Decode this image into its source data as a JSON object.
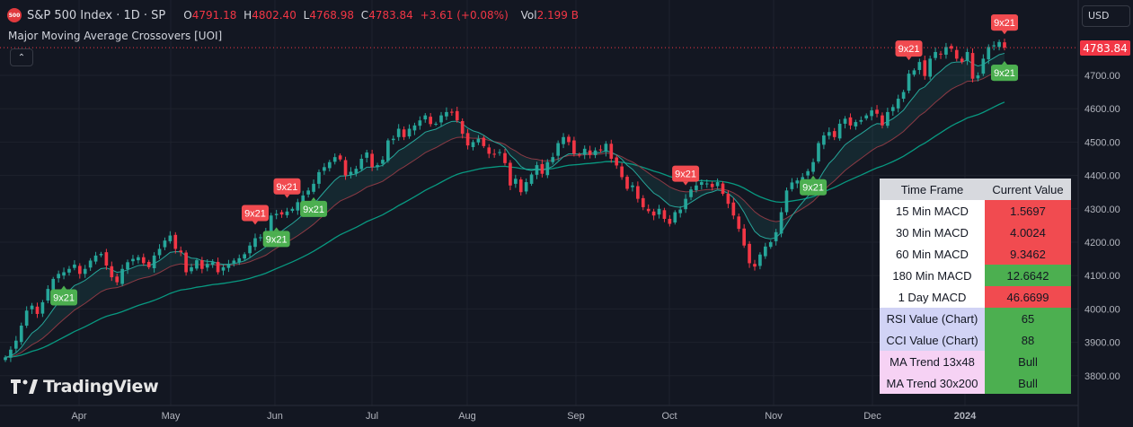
{
  "header": {
    "logo_text": "500",
    "symbol": "S&P 500 Index · 1D · SP",
    "o_label": "O",
    "o": "4791.18",
    "h_label": "H",
    "h": "4802.40",
    "l_label": "L",
    "l": "4768.98",
    "c_label": "C",
    "c": "4783.84",
    "change": "+3.61 (+0.08%)",
    "vol_label": "Vol",
    "vol": "2.199 B"
  },
  "indicator_title": "Major Moving Average Crossovers [UOI]",
  "currency": "USD",
  "last_price": "4783.84",
  "brand": "TradingView",
  "colors": {
    "up": "#26a69a",
    "down": "#f23645",
    "signal_up": "#4caf50",
    "signal_down": "#f14b50",
    "fast_ma": "#26a69a",
    "slow_ma": "#089981"
  },
  "chart_data": {
    "type": "candlestick",
    "y_axis": {
      "ticks": [
        3800,
        3900,
        4000,
        4100,
        4200,
        4300,
        4400,
        4500,
        4600,
        4700
      ],
      "range": [
        3750,
        4830
      ]
    },
    "x_axis": {
      "ticks": [
        "Apr",
        "May",
        "Jun",
        "Jul",
        "Aug",
        "Sep",
        "Oct",
        "Nov",
        "Dec",
        "2024"
      ]
    },
    "closes": [
      3855,
      3878,
      3905,
      3950,
      3995,
      4010,
      3985,
      4020,
      4060,
      4090,
      4105,
      4110,
      4120,
      4133,
      4105,
      4120,
      4145,
      4160,
      4165,
      4130,
      4095,
      4080,
      4120,
      4140,
      4150,
      4155,
      4137,
      4125,
      4160,
      4180,
      4205,
      4220,
      4180,
      4170,
      4110,
      4125,
      4146,
      4120,
      4135,
      4140,
      4110,
      4125,
      4135,
      4145,
      4152,
      4164,
      4190,
      4212,
      4215,
      4230,
      4280,
      4285,
      4283,
      4292,
      4300,
      4320,
      4340,
      4355,
      4375,
      4410,
      4425,
      4440,
      4455,
      4448,
      4400,
      4411,
      4420,
      4450,
      4469,
      4425,
      4431,
      4447,
      4505,
      4510,
      4540,
      4515,
      4540,
      4550,
      4565,
      4580,
      4554,
      4555,
      4580,
      4590,
      4588,
      4565,
      4525,
      4490,
      4500,
      4510,
      4488,
      4465,
      4464,
      4470,
      4437,
      4370,
      4390,
      4350,
      4380,
      4403,
      4431,
      4405,
      4440,
      4455,
      4497,
      4515,
      4500,
      4465,
      4460,
      4480,
      4462,
      4475,
      4475,
      4495,
      4450,
      4430,
      4395,
      4360,
      4370,
      4330,
      4305,
      4293,
      4280,
      4300,
      4270,
      4255,
      4290,
      4298,
      4330,
      4358,
      4370,
      4380,
      4376,
      4365,
      4380,
      4345,
      4315,
      4280,
      4240,
      4190,
      4137,
      4127,
      4163,
      4187,
      4200,
      4230,
      4290,
      4355,
      4379,
      4385,
      4395,
      4413,
      4440,
      4497,
      4520,
      4530,
      4515,
      4555,
      4570,
      4550,
      4560,
      4566,
      4580,
      4595,
      4585,
      4550,
      4590,
      4605,
      4630,
      4650,
      4705,
      4715,
      4740,
      4698,
      4750,
      4770,
      4763,
      4785,
      4780,
      4750,
      4740,
      4770,
      4690,
      4700,
      4750,
      4785,
      4790,
      4800,
      4783
    ],
    "signals": [
      {
        "label": "9x21",
        "type": "bullish",
        "index": 11
      },
      {
        "label": "9x21",
        "type": "bearish",
        "index": 47
      },
      {
        "label": "9x21",
        "type": "bearish",
        "index": 53
      },
      {
        "label": "9x21",
        "type": "bullish",
        "index": 51
      },
      {
        "label": "9x21",
        "type": "bullish",
        "index": 58
      },
      {
        "label": "9x21",
        "type": "bearish",
        "index": 128
      },
      {
        "label": "9x21",
        "type": "bullish",
        "index": 152
      },
      {
        "label": "9x21",
        "type": "bearish",
        "index": 170
      },
      {
        "label": "9x21",
        "type": "bullish",
        "index": 189
      },
      {
        "label": "9x21",
        "type": "bearish",
        "index": 199
      },
      {
        "label": "9x21",
        "type": "bullish",
        "index": 212
      },
      {
        "label": "9x21",
        "type": "bearish",
        "index": 266
      }
    ]
  },
  "table": {
    "headers": [
      "Time Frame",
      "Current Value"
    ],
    "rows": [
      {
        "label": "15 Min MACD",
        "value": "1.5697",
        "label_color": "#ffffff",
        "value_color": "#f14b50"
      },
      {
        "label": "30 Min MACD",
        "value": "4.0024",
        "label_color": "#ffffff",
        "value_color": "#f14b50"
      },
      {
        "label": "60 Min MACD",
        "value": "9.3462",
        "label_color": "#ffffff",
        "value_color": "#f14b50"
      },
      {
        "label": "180 Min MACD",
        "value": "12.6642",
        "label_color": "#ffffff",
        "value_color": "#4caf50"
      },
      {
        "label": "1 Day MACD",
        "value": "46.6699",
        "label_color": "#ffffff",
        "value_color": "#f14b50"
      },
      {
        "label": "RSI Value (Chart)",
        "value": "65",
        "label_color": "#d1d3f5",
        "value_color": "#4caf50"
      },
      {
        "label": "CCI Value (Chart)",
        "value": "88",
        "label_color": "#d1d3f5",
        "value_color": "#4caf50"
      },
      {
        "label": "MA Trend 13x48",
        "value": "Bull",
        "label_color": "#f6d2f4",
        "value_color": "#4caf50"
      },
      {
        "label": "MA Trend 30x200",
        "value": "Bull",
        "label_color": "#f6d2f4",
        "value_color": "#4caf50"
      }
    ]
  }
}
